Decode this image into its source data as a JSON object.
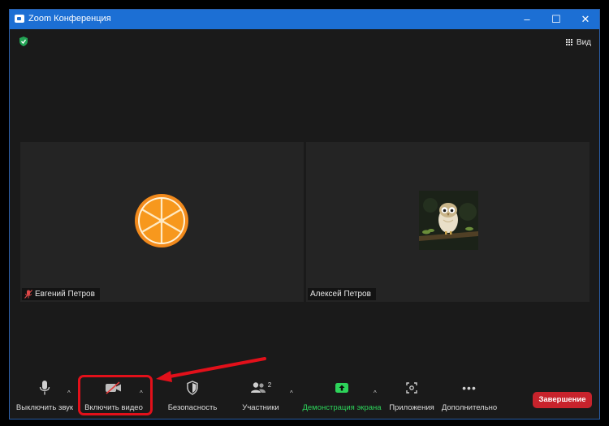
{
  "window": {
    "title": "Zoom Конференция",
    "controls": [
      "minimize-icon",
      "maximize-icon",
      "close-icon"
    ]
  },
  "header": {
    "view_label": "Вид"
  },
  "participants": [
    {
      "name": "Евгений Петров",
      "avatar": "orange-slice",
      "muted": true
    },
    {
      "name": "Алексей Петров",
      "avatar": "owl-photo",
      "muted": false
    }
  ],
  "toolbar": {
    "audio_label": "Выключить звук",
    "video_label": "Включить видео",
    "security_label": "Безопасность",
    "participants_label": "Участники",
    "participants_count": "2",
    "share_label": "Демонстрация экрана",
    "apps_label": "Приложения",
    "more_label": "Дополнительно",
    "end_label": "Завершение"
  },
  "colors": {
    "titlebar": "#1c6fd4",
    "share_green": "#2dd35a",
    "end_red": "#c8232c",
    "annotation_red": "#e2101a"
  }
}
